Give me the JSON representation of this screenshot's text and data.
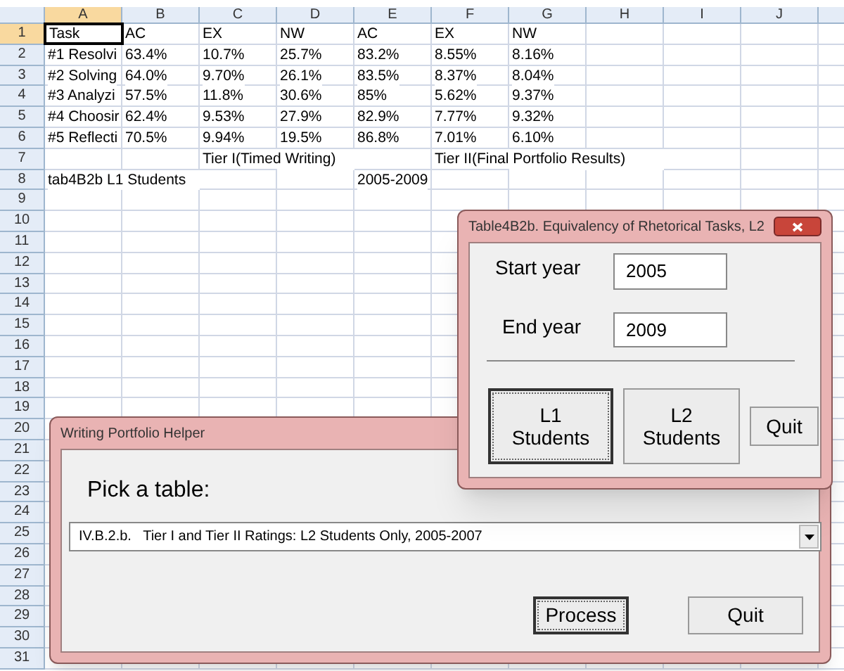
{
  "sheet": {
    "columns": [
      "A",
      "B",
      "C",
      "D",
      "E",
      "F",
      "G",
      "H",
      "I",
      "J"
    ],
    "rows": [
      {
        "number": "1",
        "cells": [
          {
            "text": "Task",
            "selected": true
          },
          {
            "text": "AC",
            "selected": false
          },
          {
            "text": "EX",
            "selected": false
          },
          {
            "text": "NW",
            "selected": false
          },
          {
            "text": "AC",
            "selected": false
          },
          {
            "text": "EX",
            "selected": false
          },
          {
            "text": "NW",
            "selected": false
          }
        ]
      },
      {
        "number": "2",
        "cells": [
          {
            "text": "#1 Resolvi",
            "selected": false
          },
          {
            "text": "63.4%",
            "selected": false
          },
          {
            "text": "10.7%",
            "selected": false
          },
          {
            "text": "25.7%",
            "selected": false
          },
          {
            "text": "83.2%",
            "selected": false
          },
          {
            "text": "8.55%",
            "selected": false
          },
          {
            "text": "8.16%",
            "selected": false
          }
        ]
      },
      {
        "number": "3",
        "cells": [
          {
            "text": "#2 Solving",
            "selected": false
          },
          {
            "text": "64.0%",
            "selected": false
          },
          {
            "text": "9.70%",
            "selected": false
          },
          {
            "text": "26.1%",
            "selected": false
          },
          {
            "text": "83.5%",
            "selected": false
          },
          {
            "text": "8.37%",
            "selected": false
          },
          {
            "text": "8.04%",
            "selected": false
          }
        ]
      },
      {
        "number": "4",
        "cells": [
          {
            "text": "#3 Analyzi",
            "selected": false
          },
          {
            "text": "57.5%",
            "selected": false
          },
          {
            "text": "11.8%",
            "selected": false
          },
          {
            "text": "30.6%",
            "selected": false
          },
          {
            "text": "85%",
            "selected": false
          },
          {
            "text": "5.62%",
            "selected": false
          },
          {
            "text": "9.37%",
            "selected": false
          }
        ]
      },
      {
        "number": "5",
        "cells": [
          {
            "text": "#4 Choosir",
            "selected": false
          },
          {
            "text": "62.4%",
            "selected": false
          },
          {
            "text": "9.53%",
            "selected": false
          },
          {
            "text": "27.9%",
            "selected": false
          },
          {
            "text": "82.9%",
            "selected": false
          },
          {
            "text": "7.77%",
            "selected": false
          },
          {
            "text": "9.32%",
            "selected": false
          }
        ]
      },
      {
        "number": "6",
        "cells": [
          {
            "text": "#5 Reflecti",
            "selected": false
          },
          {
            "text": "70.5%",
            "selected": false
          },
          {
            "text": "9.94%",
            "selected": false
          },
          {
            "text": "19.5%",
            "selected": false
          },
          {
            "text": "86.8%",
            "selected": false
          },
          {
            "text": "7.01%",
            "selected": false
          },
          {
            "text": "6.10%",
            "selected": false
          }
        ]
      },
      {
        "number": "7",
        "cells": [
          null,
          null,
          {
            "text": "Tier I(Timed Writing)",
            "selected": false
          },
          null,
          null,
          {
            "text": "Tier II(Final Portfolio Results)",
            "selected": false
          }
        ]
      },
      {
        "number": "8",
        "cells": [
          {
            "text": "tab4B2b L1 Students",
            "selected": false
          },
          null,
          null,
          null,
          {
            "text": "2005-2009",
            "selected": false
          }
        ]
      },
      {
        "number": "9"
      },
      {
        "number": "10"
      },
      {
        "number": "11"
      },
      {
        "number": "12"
      },
      {
        "number": "13"
      },
      {
        "number": "14"
      },
      {
        "number": "15"
      },
      {
        "number": "16"
      },
      {
        "number": "17"
      },
      {
        "number": "18"
      },
      {
        "number": "19"
      },
      {
        "number": "20"
      },
      {
        "number": "21"
      },
      {
        "number": "22"
      },
      {
        "number": "23"
      },
      {
        "number": "24"
      },
      {
        "number": "25"
      },
      {
        "number": "26"
      },
      {
        "number": "27"
      },
      {
        "number": "28"
      },
      {
        "number": "29"
      },
      {
        "number": "30"
      },
      {
        "number": "31"
      }
    ]
  },
  "helper_dialog": {
    "title": "Writing Portfolio Helper",
    "label": "Pick a table:",
    "dropdown": {
      "value": "IV.B.2.b.   Tier I and Tier II Ratings: L2 Students Only, 2005-2007"
    },
    "buttons": [
      {
        "label": "Process",
        "default": true
      },
      {
        "label": "Quit",
        "default": false
      }
    ]
  },
  "table_dialog": {
    "title": "Table4B2b. Equivalency of Rhetorical Tasks, L2",
    "start_label": "Start year",
    "start_value": "2005",
    "end_label": "End year",
    "end_value": "2009",
    "buttons": [
      {
        "label": "L1\nStudents",
        "default": true
      },
      {
        "label": "L2\nStudents",
        "default": false
      },
      {
        "label": "Quit",
        "default": false
      }
    ]
  }
}
